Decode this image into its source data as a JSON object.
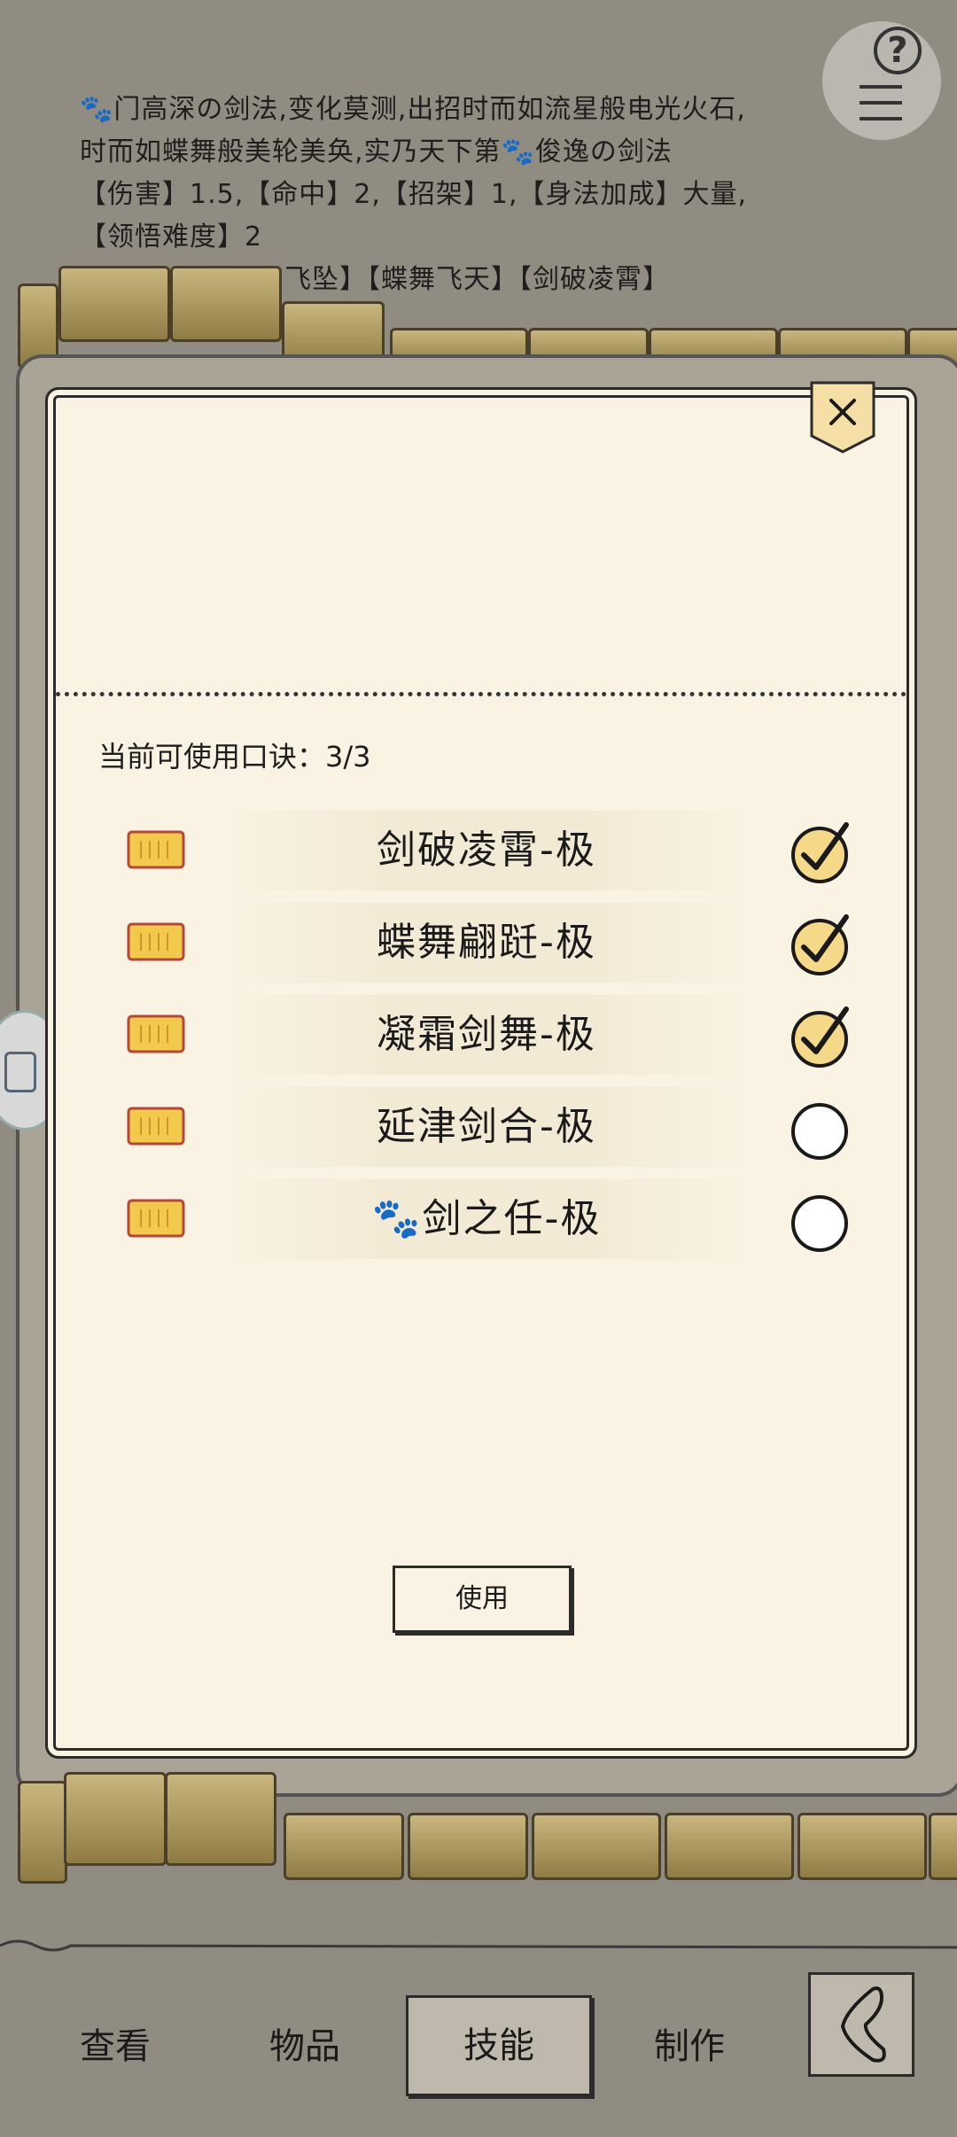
{
  "description": {
    "lines": [
      "🐾门高深の剑法,变化莫测,出招时而如流星般电光火石,",
      "时而如蝶舞般美轮美奂,实乃天下第🐾俊逸の剑法",
      "【伤害】1.5,【命中】2,【招架】1,【身法加成】大量,",
      "【领悟难度】2",
      "星飞坠】【蝶舞飞天】【剑破凌霄】"
    ]
  },
  "help_button": {
    "symbol": "?"
  },
  "dialog": {
    "quota_label": "当前可使用口诀：3/3",
    "skills": [
      {
        "name": "剑破凌霄-极",
        "checked": true
      },
      {
        "name": "蝶舞翩跹-极",
        "checked": true
      },
      {
        "name": "凝霜剑舞-极",
        "checked": true
      },
      {
        "name": "延津剑合-极",
        "checked": false
      },
      {
        "name": "🐾剑之任-极",
        "checked": false
      }
    ],
    "use_button": "使用",
    "close_symbol": "×"
  },
  "bottom_nav": {
    "items": [
      {
        "label": "查看",
        "active": false
      },
      {
        "label": "物品",
        "active": false
      },
      {
        "label": "技能",
        "active": true
      },
      {
        "label": "制作",
        "active": false
      }
    ]
  },
  "colors": {
    "paper": "#faf3e3",
    "background": "#918c82",
    "ink": "#2b2b2b",
    "chip_gold": "#f2c94c"
  },
  "icons": [
    "help-icon",
    "menu-icon",
    "close-icon",
    "scroll-chip-icon",
    "checkmark-icon",
    "back-arrow-icon"
  ]
}
